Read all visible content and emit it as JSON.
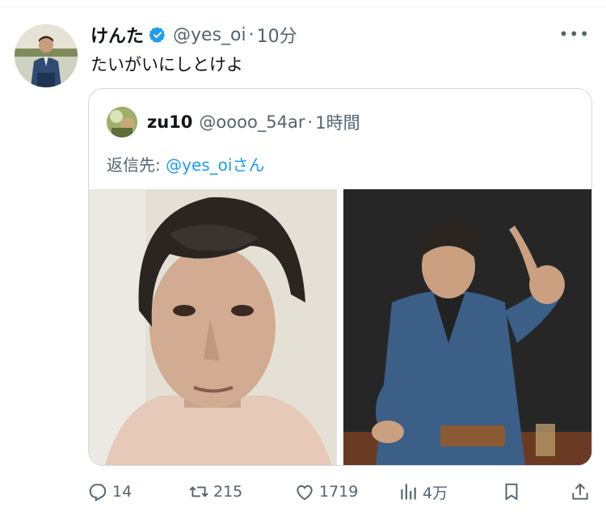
{
  "tweet": {
    "author_name": "けんた",
    "author_handle": "@yes_oi",
    "separator": "·",
    "time": "10分",
    "text": "たいがいにしとけよ",
    "more_label": "•••"
  },
  "quote": {
    "author_name": "zu10",
    "author_handle": "@oooo_54ar",
    "separator": "·",
    "time": "1時間",
    "reply_prefix": "返信先: ",
    "reply_mention": "@yes_oi",
    "reply_suffix": "さん"
  },
  "actions": {
    "replies": "14",
    "retweets": "215",
    "likes": "1719",
    "views": "4万"
  },
  "colors": {
    "verified": "#1d9bf0",
    "link": "#1d9bf0",
    "secondary_text": "#536471",
    "border": "#cfd9de"
  }
}
